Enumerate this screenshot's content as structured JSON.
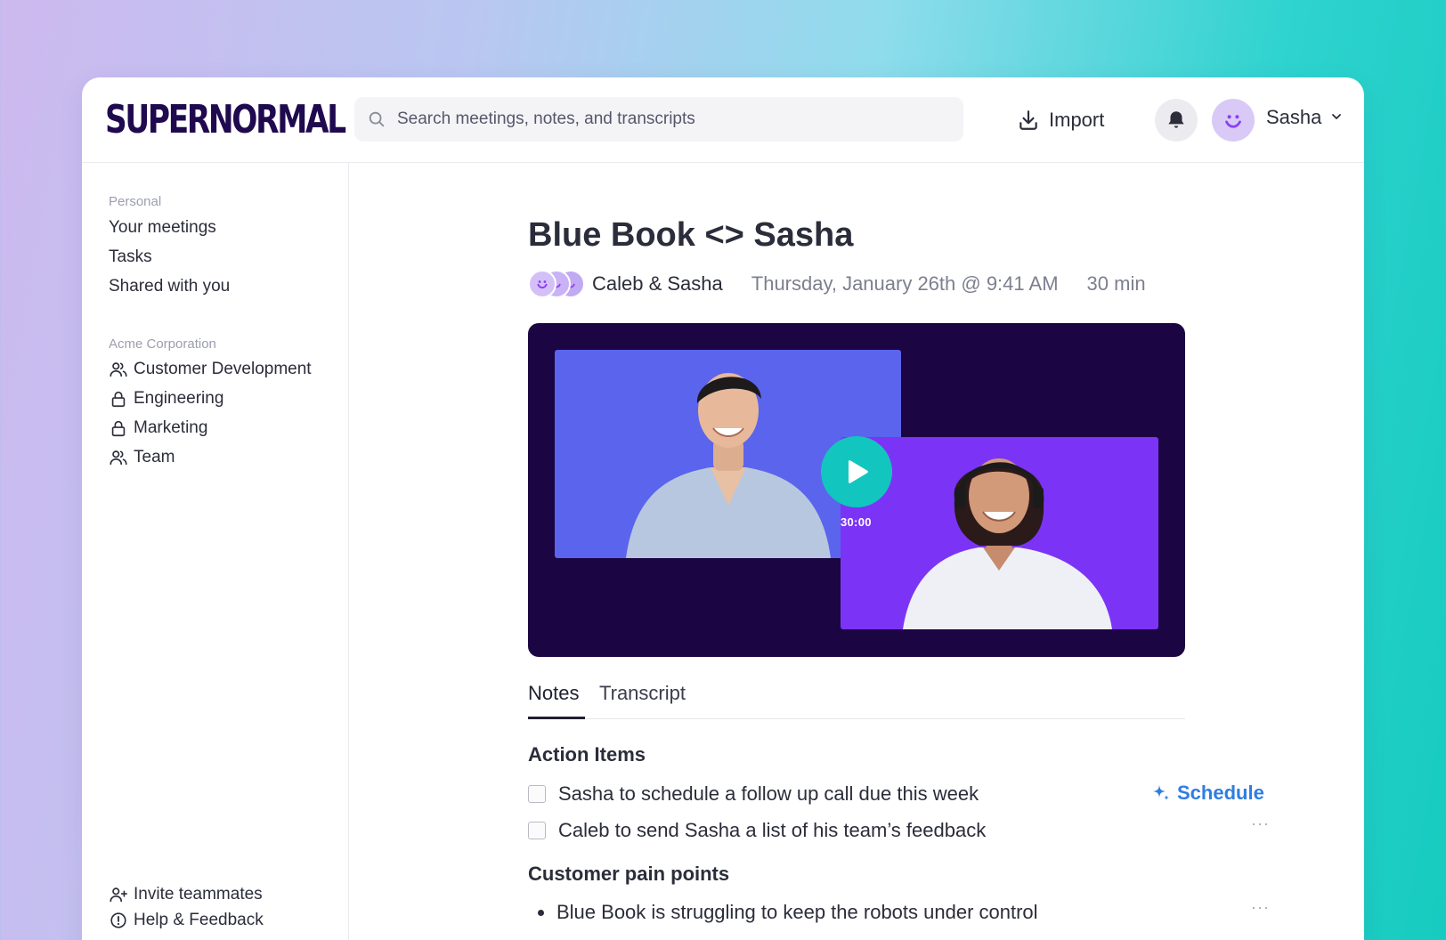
{
  "header": {
    "logo_text": "supernormal",
    "search_placeholder": "Search meetings, notes, and transcripts",
    "import_label": "Import",
    "user_name": "Sasha"
  },
  "sidebar": {
    "personal_label": "Personal",
    "personal_items": [
      "Your meetings",
      "Tasks",
      "Shared with you"
    ],
    "org_label": "Acme Corporation",
    "org_items": [
      {
        "label": "Customer Development",
        "icon": "people-icon"
      },
      {
        "label": "Engineering",
        "icon": "lock-icon"
      },
      {
        "label": "Marketing",
        "icon": "lock-icon"
      },
      {
        "label": "Team",
        "icon": "people-icon"
      }
    ],
    "bottom_items": [
      {
        "label": "Invite teammates",
        "icon": "add-person-icon"
      },
      {
        "label": "Help & Feedback",
        "icon": "info-icon"
      }
    ]
  },
  "meeting": {
    "title": "Blue Book <> Sasha",
    "participants": "Caleb & Sasha",
    "date": "Thursday, January 26th @ 9:41 AM",
    "duration": "30 min",
    "video_time": "30:00"
  },
  "tabs": [
    "Notes",
    "Transcript"
  ],
  "notes": {
    "action_items_heading": "Action Items",
    "action_items": [
      "Sasha to schedule a follow up call due this week",
      "Caleb to send Sasha a list of his team’s feedback"
    ],
    "schedule_label": "Schedule",
    "more_label": "···",
    "pain_points_heading": "Customer pain points",
    "pain_points": [
      "Blue Book is struggling to keep the robots under control"
    ]
  },
  "colors": {
    "brand": "#1f0a4f",
    "accent_teal": "#12c6bf",
    "link_blue": "#2f7de1",
    "video_bg": "#1c0543"
  }
}
